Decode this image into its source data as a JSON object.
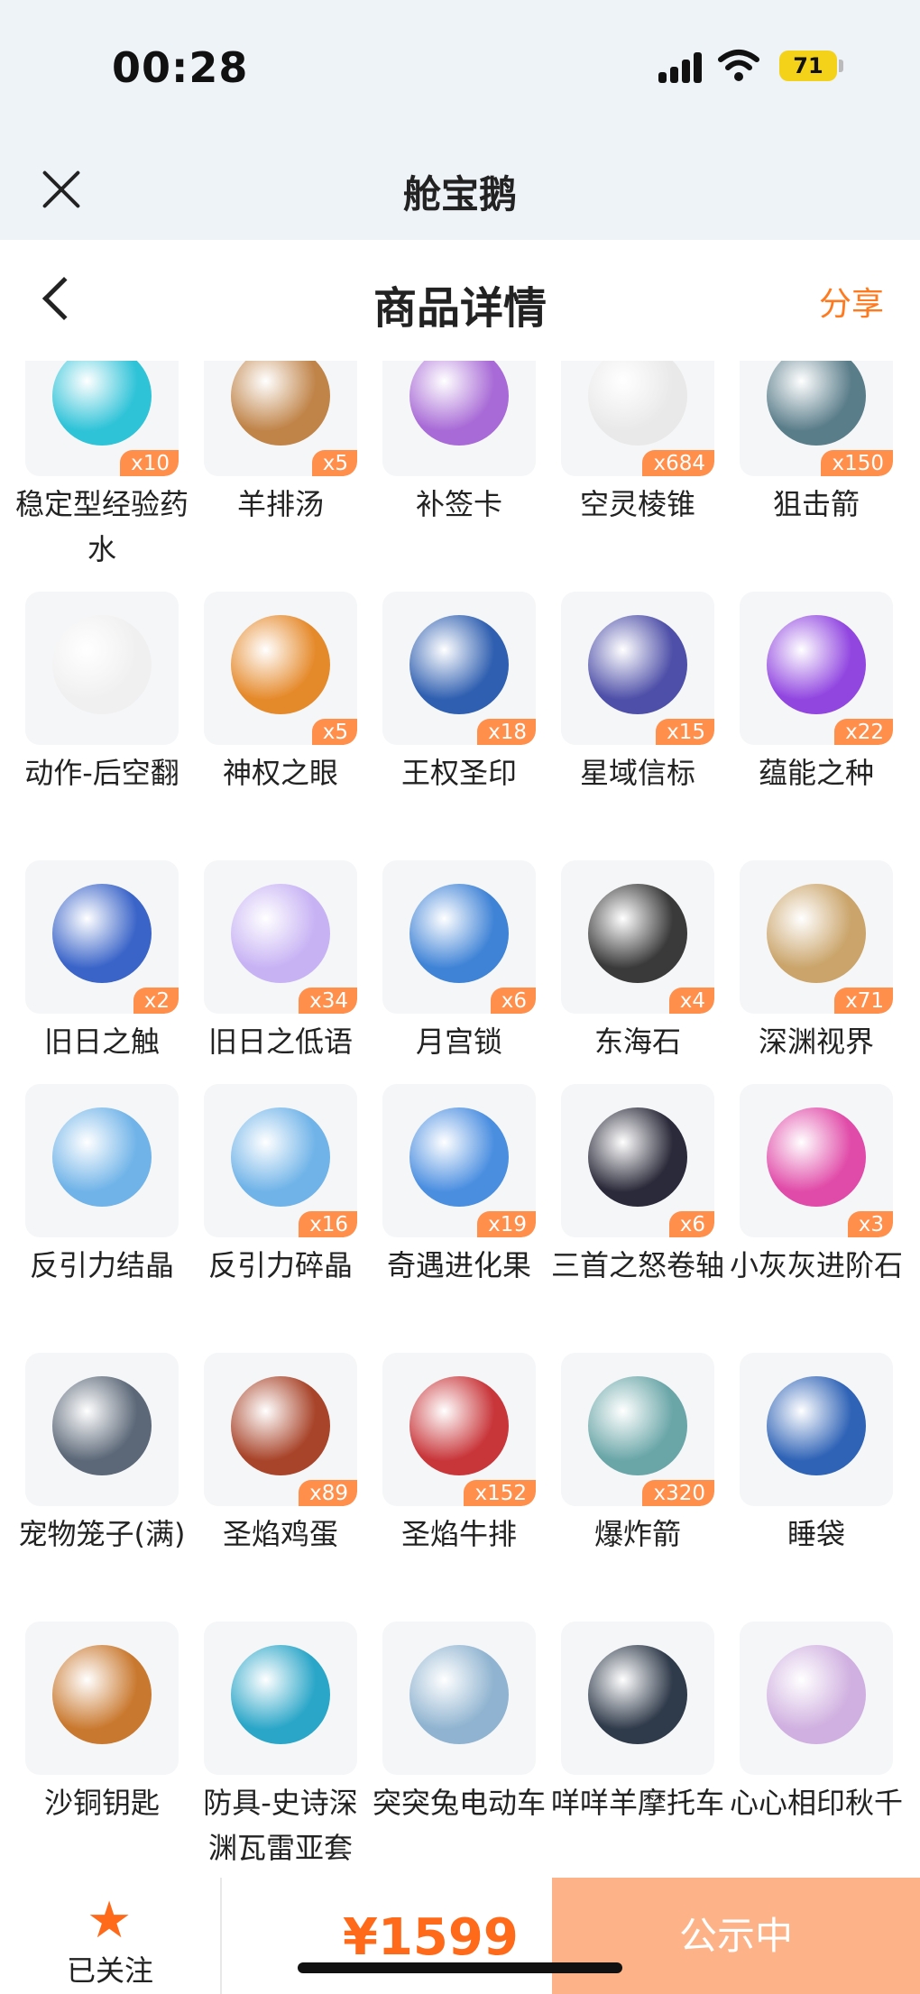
{
  "status_bar": {
    "time": "00:28",
    "battery": "71"
  },
  "app_bar": {
    "title": "舱宝鹅"
  },
  "header": {
    "title": "商品详情",
    "share": "分享"
  },
  "items": [
    {
      "name": "稳定型经验药水",
      "qty": "x10",
      "color": "#2fc3d8"
    },
    {
      "name": "羊排汤",
      "qty": "x5",
      "color": "#c08449"
    },
    {
      "name": "补签卡",
      "qty": "",
      "color": "#a86ad6"
    },
    {
      "name": "空灵棱锥",
      "qty": "x684",
      "color": "#e9e9e9"
    },
    {
      "name": "狙击箭",
      "qty": "x150",
      "color": "#5a7d8a"
    },
    {
      "name": "动作-后空翻",
      "qty": "",
      "color": "#f0f0f0"
    },
    {
      "name": "神权之眼",
      "qty": "x5",
      "color": "#e58a2b"
    },
    {
      "name": "王权圣印",
      "qty": "x18",
      "color": "#2f5fb0"
    },
    {
      "name": "星域信标",
      "qty": "x15",
      "color": "#4e4fa8"
    },
    {
      "name": "蕴能之种",
      "qty": "x22",
      "color": "#9146e0"
    },
    {
      "name": "旧日之触",
      "qty": "x2",
      "color": "#3a64c8"
    },
    {
      "name": "旧日之低语",
      "qty": "x34",
      "color": "#c7b2f4"
    },
    {
      "name": "月宫锁",
      "qty": "x6",
      "color": "#3f83d6"
    },
    {
      "name": "东海石",
      "qty": "x4",
      "color": "#3a3a3a"
    },
    {
      "name": "深渊视界",
      "qty": "x71",
      "color": "#caa46a"
    },
    {
      "name": "反引力结晶",
      "qty": "",
      "color": "#6fb3e8"
    },
    {
      "name": "反引力碎晶",
      "qty": "x16",
      "color": "#6fb3e8"
    },
    {
      "name": "奇遇进化果",
      "qty": "x19",
      "color": "#4a8ee0"
    },
    {
      "name": "三首之怒卷轴",
      "qty": "x6",
      "color": "#2a2a3a"
    },
    {
      "name": "小灰灰进阶石",
      "qty": "x3",
      "color": "#e04aa8"
    },
    {
      "name": "宠物笼子(满)",
      "qty": "",
      "color": "#5c6878"
    },
    {
      "name": "圣焰鸡蛋",
      "qty": "x89",
      "color": "#a8442a"
    },
    {
      "name": "圣焰牛排",
      "qty": "x152",
      "color": "#c8363a"
    },
    {
      "name": "爆炸箭",
      "qty": "x320",
      "color": "#6aa6a8"
    },
    {
      "name": "睡袋",
      "qty": "",
      "color": "#2f63b6"
    },
    {
      "name": "沙铜钥匙",
      "qty": "",
      "color": "#c9792f"
    },
    {
      "name": "防具-史诗深渊瓦雷亚套",
      "qty": "",
      "color": "#2aa6c8"
    },
    {
      "name": "突突兔电动车",
      "qty": "",
      "color": "#8fb3d0"
    },
    {
      "name": "咩咩羊摩托车",
      "qty": "",
      "color": "#2f3a4a"
    },
    {
      "name": "心心相印秋千",
      "qty": "",
      "color": "#d0b0e0"
    }
  ],
  "bottom_bar": {
    "follow_label": "已关注",
    "price": "¥1599",
    "status_button": "公示中"
  }
}
